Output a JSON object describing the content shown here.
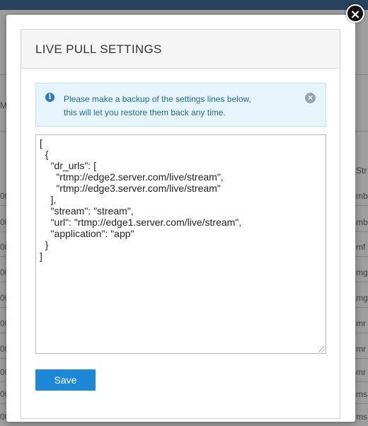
{
  "background": {
    "rows": [
      {
        "left": "00",
        "right": "mb"
      },
      {
        "left": "00",
        "right": "mb"
      },
      {
        "left": "00",
        "right": "mf"
      },
      {
        "left": "00",
        "right": "mg"
      },
      {
        "left": "00",
        "right": "mg"
      },
      {
        "left": "00",
        "right": "mr"
      },
      {
        "left": "00",
        "right": "mr"
      },
      {
        "left": "00",
        "right": "mr"
      },
      {
        "left": "00",
        "right": "ms"
      },
      {
        "left": "00",
        "right": "ms"
      }
    ],
    "header_right": "Str",
    "side_letter": "M"
  },
  "modal": {
    "close_glyph": "×",
    "title": "LIVE PULL SETTINGS",
    "alert": {
      "line1": "Please make a backup of the settings lines below,",
      "line2": "this will let you restore them back any time.",
      "icon_glyph": "i",
      "close_glyph": "×"
    },
    "editor": {
      "content": "[\n  {\n    \"dr_urls\": [\n      \"rtmp://edge2.server.com/live/stream\",\n      \"rtmp://edge3.server.com/live/stream\"\n    ],\n    \"stream\": \"stream\",\n    \"url\": \"rtmp://edge1.server.com/live/stream\",\n    \"application\": \"app\"\n  }\n]"
    },
    "save_label": "Save"
  },
  "colors": {
    "primary_button": "#1e88d8",
    "alert_bg": "#e6f5fc",
    "alert_text": "#1f6a91",
    "topbar": "#3c6d95"
  }
}
